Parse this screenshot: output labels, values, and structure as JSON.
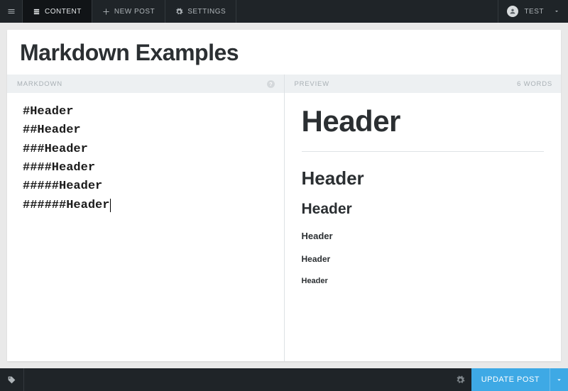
{
  "topbar": {
    "nav": [
      {
        "label": "CONTENT",
        "icon": "content"
      },
      {
        "label": "NEW POST",
        "icon": "plus"
      },
      {
        "label": "SETTINGS",
        "icon": "gear"
      }
    ],
    "user": {
      "name": "TEST"
    }
  },
  "post": {
    "title": "Markdown Examples"
  },
  "editor": {
    "markdown_label": "MARKDOWN",
    "preview_label": "PREVIEW",
    "word_count": "6 WORDS",
    "lines": [
      "#Header",
      "##Header",
      "###Header",
      "####Header",
      "#####Header",
      "######Header"
    ]
  },
  "preview": {
    "h1": "Header",
    "h2": "Header",
    "h3": "Header",
    "h4": "Header",
    "h5": "Header",
    "h6": "Header"
  },
  "bottombar": {
    "update_label": "UPDATE POST"
  }
}
